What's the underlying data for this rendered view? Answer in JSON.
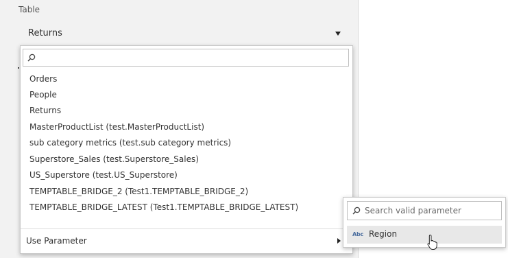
{
  "table_section": {
    "label": "Table",
    "selected_value": "Returns"
  },
  "table_dropdown": {
    "search_placeholder": "",
    "items": [
      "Orders",
      "People",
      "Returns",
      "MasterProductList (test.MasterProductList)",
      "sub category metrics (test.sub category metrics)",
      "Superstore_Sales (test.Superstore_Sales)",
      "US_Superstore (test.US_Superstore)",
      "TEMPTABLE_BRIDGE_2 (Test1.TEMPTABLE_BRIDGE_2)",
      "TEMPTABLE_BRIDGE_LATEST (Test1.TEMPTABLE_BRIDGE_LATEST)"
    ],
    "use_parameter_label": "Use Parameter"
  },
  "parameter_submenu": {
    "search_placeholder": "Search valid parameter",
    "items": [
      {
        "type_badge": "Abc",
        "label": "Region"
      }
    ]
  },
  "icons": {
    "search": "search-icon",
    "dropdown_caret": "chevron-down-icon",
    "submenu_caret": "chevron-right-icon",
    "type": "string-type-icon",
    "pointer": "mouse-cursor-icon"
  },
  "colors": {
    "panel_background": "#f2f2f2",
    "menu_background": "#ffffff",
    "hover_background": "#e8e8e8",
    "type_badge": "#4a6d9e"
  }
}
